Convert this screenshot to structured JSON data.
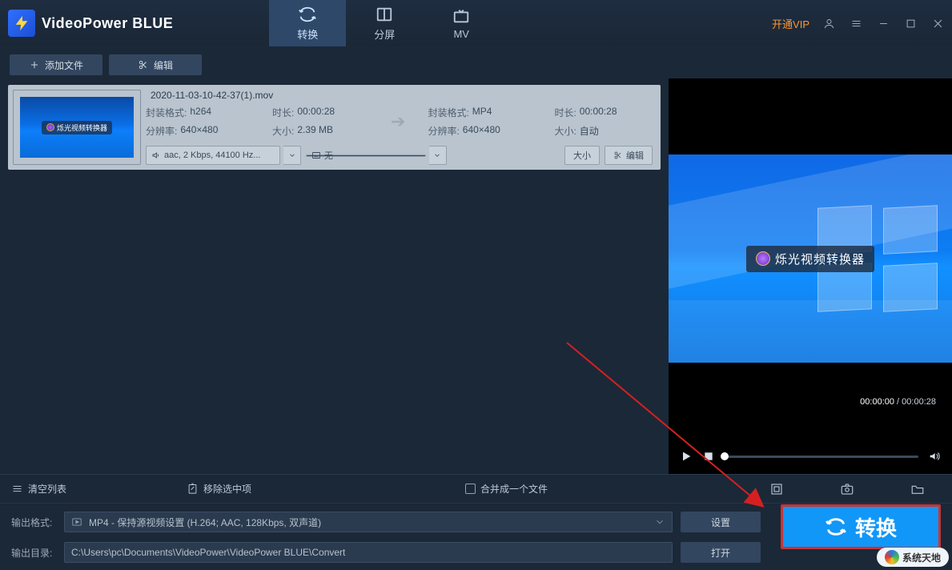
{
  "app": {
    "title": "VideoPower BLUE"
  },
  "titlebar": {
    "vip": "开通VIP"
  },
  "tabs": {
    "convert": "转换",
    "split": "分屏",
    "mv": "MV"
  },
  "toolbar": {
    "add_file": "添加文件",
    "edit": "编辑"
  },
  "file": {
    "name": "2020-11-03-10-42-37(1).mov",
    "thumb_label": "烁光视频转换器",
    "src": {
      "format_lbl": "封装格式:",
      "format": "h264",
      "res_lbl": "分辨率:",
      "res": "640×480",
      "dur_lbl": "时长:",
      "dur": "00:00:28",
      "size_lbl": "大小:",
      "size": "2.39 MB"
    },
    "dst": {
      "format_lbl": "封装格式:",
      "format": "MP4",
      "res_lbl": "分辨率:",
      "res": "640×480",
      "dur_lbl": "时长:",
      "dur": "00:00:28",
      "size_lbl": "大小:",
      "size": "自动"
    },
    "audio_dd": "aac, 2 Kbps, 44100 Hz...",
    "track_dd": "无",
    "size_btn": "大小",
    "edit_btn": "编辑"
  },
  "preview": {
    "badge": "烁光视频转换器",
    "time_cur": "00:00:00",
    "time_sep": " / ",
    "time_total": "00:00:28"
  },
  "listbar": {
    "clear": "清空列表",
    "remove_sel": "移除选中项",
    "merge": "合并成一个文件"
  },
  "output": {
    "format_lbl": "输出格式:",
    "format_value": "MP4 - 保持源视频设置 (H.264; AAC, 128Kbps, 双声道)",
    "dir_lbl": "输出目录:",
    "dir_value": "C:\\Users\\pc\\Documents\\VideoPower\\VideoPower BLUE\\Convert",
    "settings_btn": "设置",
    "open_btn": "打开",
    "convert_btn": "转换"
  },
  "watermark": "系统天地"
}
